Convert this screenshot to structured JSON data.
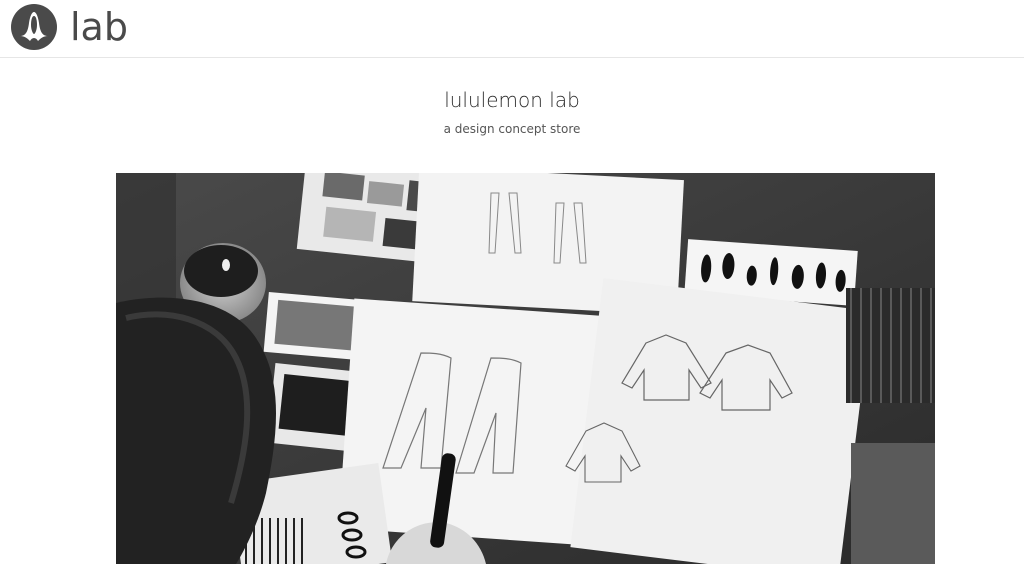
{
  "header": {
    "logo_icon": "lululemon-logo-icon",
    "brand_label": "lab"
  },
  "hero": {
    "title": "lululemon lab",
    "subtitle": "a design concept store"
  },
  "photo": {
    "icon": "design-sketches-photo"
  },
  "colors": {
    "text_dark": "#2b2b2b",
    "logo": "#4a4a4a",
    "divider": "#e6e6e6"
  }
}
